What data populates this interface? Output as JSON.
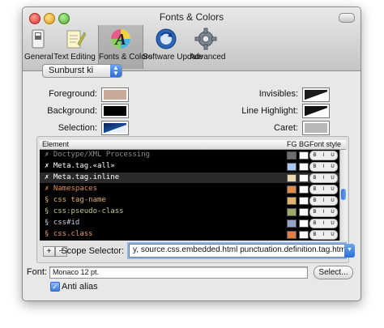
{
  "window": {
    "title": "Fonts & Colors"
  },
  "toolbar": {
    "items": [
      {
        "label": "General",
        "icon": "switch-icon"
      },
      {
        "label": "Text Editing",
        "icon": "notepad-pencil-icon"
      },
      {
        "label": "Fonts & Colors",
        "icon": "color-letter-a-icon",
        "selected": true
      },
      {
        "label": "Software Update",
        "icon": "update-globe-icon"
      },
      {
        "label": "Advanced",
        "icon": "gear-icon"
      }
    ]
  },
  "theme": {
    "selected": "Sunburst ki"
  },
  "colors": {
    "foreground": {
      "label": "Foreground:",
      "color": "#c9aa98"
    },
    "background": {
      "label": "Background:",
      "color": "#000000"
    },
    "selection": {
      "label": "Selection:",
      "color": "#1a4f9a"
    },
    "invisibles": {
      "label": "Invisibles:",
      "color": "#1a1a1a"
    },
    "line_highlight": {
      "label": "Line Highlight:",
      "color": "#111111"
    },
    "caret": {
      "label": "Caret:",
      "color": "#b8b8b8"
    }
  },
  "table": {
    "columns": {
      "element": "Element",
      "fg": "FG",
      "bg": "BG",
      "font_style": "Font style"
    },
    "style_labels": {
      "b": "B",
      "i": "I",
      "u": "U"
    },
    "rows": [
      {
        "name": "✗ Doctype/XML Processing",
        "fg": "#6e6e6e",
        "text_color": "#8c8c8c"
      },
      {
        "name": "✗ Meta.tag.«all»",
        "fg": "#a9c6ef",
        "text_color": "#ffffff"
      },
      {
        "name": "✗ Meta.tag.inline",
        "fg": "#e9d9b4",
        "text_color": "#ffffff",
        "selected": true
      },
      {
        "name": "✗ Namespaces",
        "fg": "#e28a47",
        "text_color": "#e28a47"
      },
      {
        "name": "§ css tag-name",
        "fg": "#e3b36b",
        "text_color": "#e3b36b"
      },
      {
        "name": "§ css:pseudo-class",
        "fg": "#9aa86a",
        "text_color": "#c2c88f"
      },
      {
        "name": "§ css#id",
        "fg": "#93a4c4",
        "text_color": "#c7cde0"
      },
      {
        "name": "§ css.class",
        "fg": "#e57b43",
        "text_color": "#e99b63"
      }
    ]
  },
  "buttons": {
    "add": "+",
    "remove": "−",
    "select": "Select..."
  },
  "scope": {
    "label": "Scope Selector:",
    "value": "y, source.css.embedded.html punctuation.definition.tag.html"
  },
  "font": {
    "label": "Font:",
    "value": "Monaco 12 pt."
  },
  "anti_alias": {
    "label": "Anti alias",
    "checked": true,
    "mark": "✓"
  }
}
